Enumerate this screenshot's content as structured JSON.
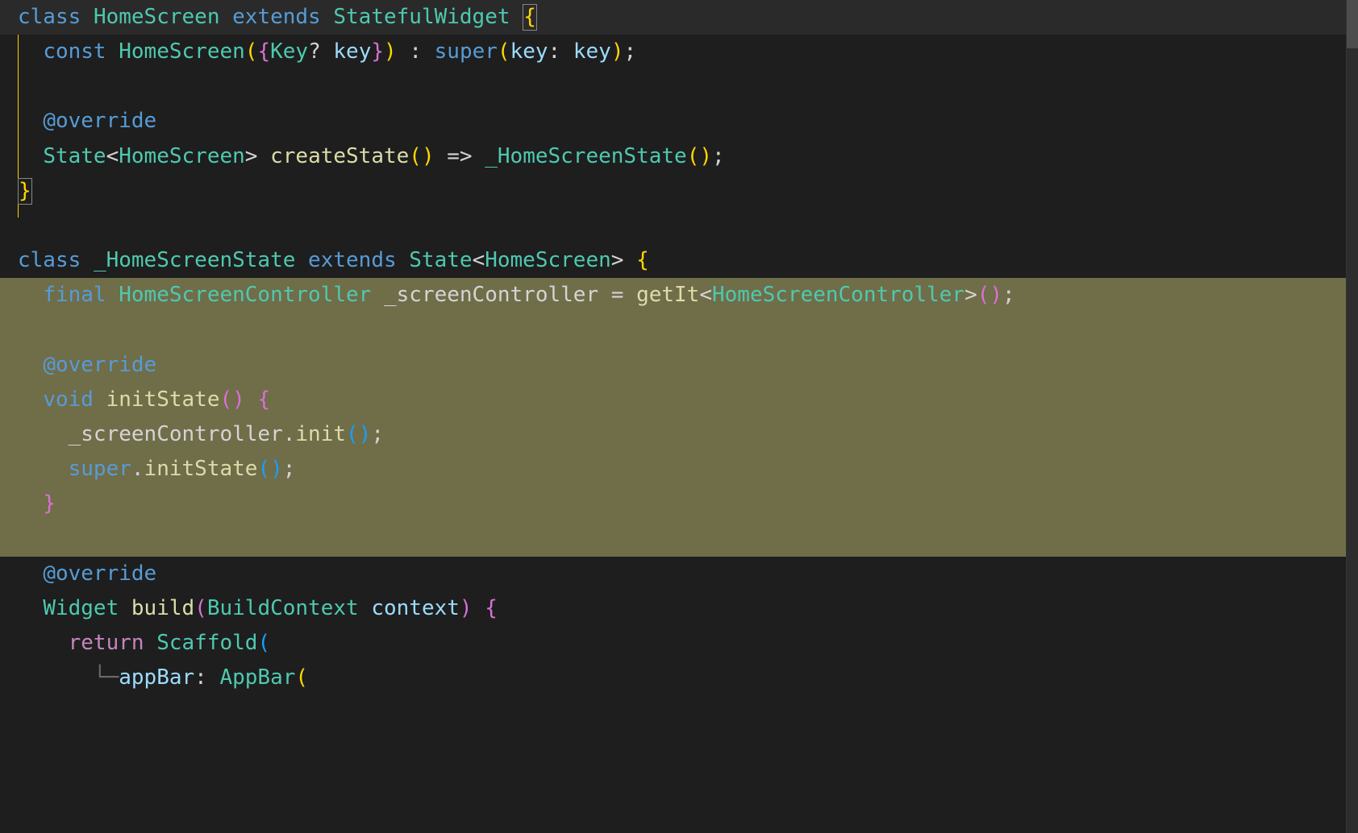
{
  "lines": {
    "l1": {
      "kw_class": "class",
      "cls_HomeScreen": "HomeScreen",
      "kw_extends": "extends",
      "cls_StatefulWidget": "StatefulWidget",
      "brace": "{"
    },
    "l2": {
      "kw_const": "const",
      "ctor": "HomeScreen",
      "p1": "(",
      "b1": "{",
      "ty_Key": "Key",
      "q": "?",
      "param_key": "key",
      "b2": "}",
      "p2": ")",
      "colon": " : ",
      "super": "super",
      "p3": "(",
      "named": "key",
      "col2": ": ",
      "arg": "key",
      "p4": ")",
      "semi": ";"
    },
    "l4": {
      "anno": "@override"
    },
    "l5": {
      "ty_State": "State",
      "lt": "<",
      "ty_HS": "HomeScreen",
      "gt": ">",
      "fn": "createState",
      "p1": "(",
      "p2": ")",
      "arrow": " => ",
      "cls": "_HomeScreenState",
      "p3": "(",
      "p4": ")",
      "semi": ";"
    },
    "l6": {
      "brace": "}"
    },
    "l8": {
      "kw_class": "class",
      "cls": "_HomeScreenState",
      "kw_extends": "extends",
      "ty_State": "State",
      "lt": "<",
      "ty_HS": "HomeScreen",
      "gt": ">",
      "brace": " {"
    },
    "l9": {
      "kw_final": "final",
      "ty": "HomeScreenController",
      "name": "_screenController",
      "eq": " = ",
      "getIt": "getIt",
      "lt": "<",
      "ty2": "HomeScreenController",
      "gt": ">",
      "p1": "(",
      "p2": ")",
      "semi": ";"
    },
    "l11": {
      "anno": "@override"
    },
    "l12": {
      "kw_void": "void",
      "fn": "initState",
      "p1": "(",
      "p2": ")",
      "brace": " {"
    },
    "l13": {
      "obj": "_screenController",
      "dot": ".",
      "fn": "init",
      "p1": "(",
      "p2": ")",
      "semi": ";"
    },
    "l14": {
      "super": "super",
      "dot": ".",
      "fn": "initState",
      "p1": "(",
      "p2": ")",
      "semi": ";"
    },
    "l15": {
      "brace": "}"
    },
    "l17": {
      "anno": "@override"
    },
    "l18": {
      "ty": "Widget",
      "fn": "build",
      "p1": "(",
      "ty2": "BuildContext",
      "param": "context",
      "p2": ")",
      "brace": " {"
    },
    "l19": {
      "kw_return": "return",
      "cls": "Scaffold",
      "p1": "("
    },
    "l20": {
      "guide": "└─",
      "named": "appBar",
      "col": ": ",
      "cls": "AppBar",
      "p1": "("
    }
  }
}
